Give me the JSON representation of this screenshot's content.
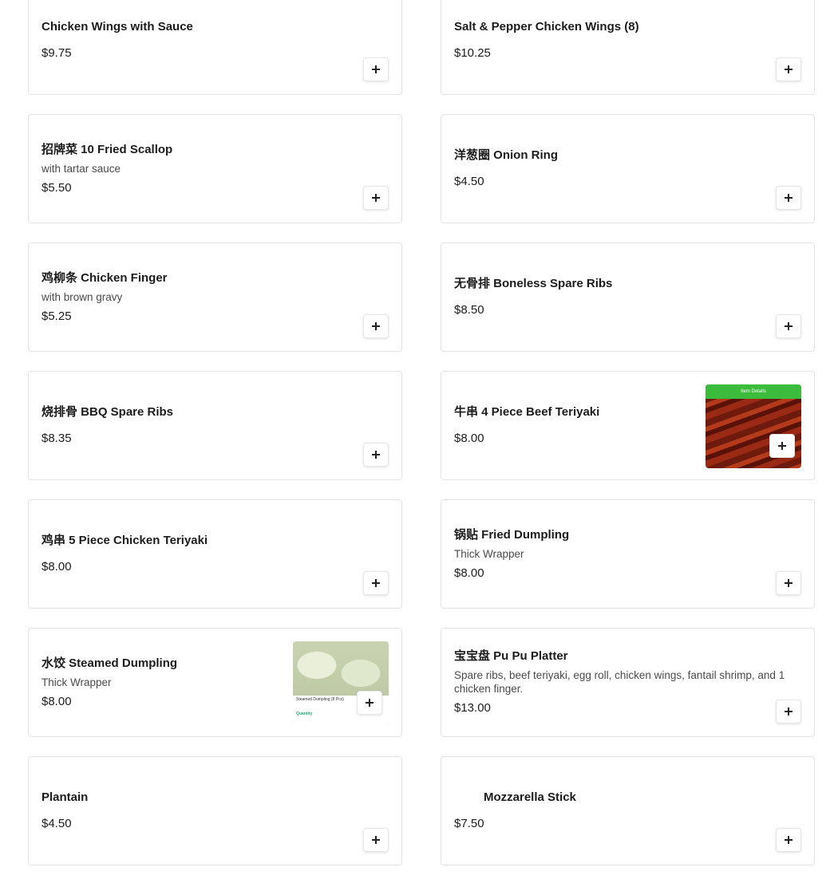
{
  "items": [
    {
      "name": "Chicken Wings with Sauce",
      "price": "$9.75"
    },
    {
      "name": "Salt & Pepper Chicken Wings (8)",
      "price": "$10.25"
    },
    {
      "name": "招牌菜 10 Fried Scallop",
      "desc": "with tartar sauce",
      "price": "$5.50"
    },
    {
      "name": "洋葱圈 Onion Ring",
      "price": "$4.50"
    },
    {
      "name": "鸡柳条 Chicken Finger",
      "desc": "with brown gravy",
      "price": "$5.25"
    },
    {
      "name": "无骨排 Boneless Spare Ribs",
      "price": "$8.50"
    },
    {
      "name": "烧排骨 BBQ Spare Ribs",
      "price": "$8.35"
    },
    {
      "name": "牛串 4 Piece Beef Teriyaki",
      "price": "$8.00",
      "image": "beef-teriyaki-photo",
      "image_caption": "Item Details"
    },
    {
      "name": "鸡串 5 Piece Chicken Teriyaki",
      "price": "$8.00"
    },
    {
      "name": "锅贴 Fried Dumpling",
      "desc": "Thick Wrapper",
      "price": "$8.00"
    },
    {
      "name": "水饺 Steamed Dumpling",
      "desc": "Thick Wrapper",
      "price": "$8.00",
      "image": "steamed-dumpling-photo",
      "image_caption": "Steamed Dumpling (8 Pcs)",
      "image_qty": "Quantity"
    },
    {
      "name": "宝宝盘 Pu Pu Platter",
      "desc": "Spare ribs, beef teriyaki, egg roll, chicken wings, fantail shrimp, and 1 chicken finger.",
      "price": "$13.00"
    },
    {
      "name": "Plantain",
      "price": "$4.50"
    },
    {
      "name": "Mozzarella Stick",
      "price": "$7.50"
    }
  ],
  "add_button_icon": "plus-icon"
}
